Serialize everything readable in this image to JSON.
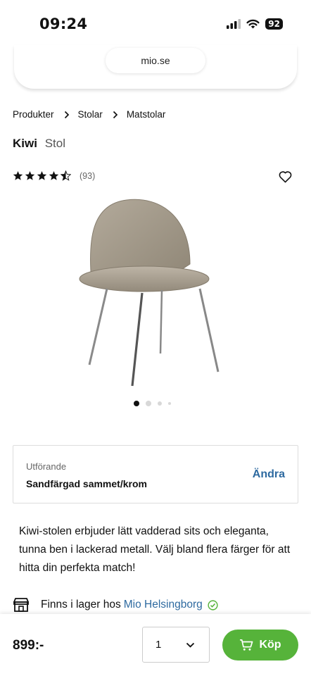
{
  "status": {
    "time": "09:24",
    "battery": "92"
  },
  "browser": {
    "url": "mio.se"
  },
  "breadcrumb": [
    "Produkter",
    "Stolar",
    "Matstolar"
  ],
  "product": {
    "name": "Kiwi",
    "type": "Stol",
    "rating": 4.5,
    "review_count": "(93)",
    "image_count": 4,
    "active_image": 1
  },
  "variant": {
    "label": "Utförande",
    "value": "Sandfärgad sammet/krom",
    "change_label": "Ändra"
  },
  "description": "Kiwi-stolen erbjuder lätt vadderad sits och eleganta, tunna ben i lackerad metall. Välj bland flera färger för att hitta din perfekta match!",
  "stock": {
    "text": "Finns i lager hos",
    "store": "Mio Helsingborg"
  },
  "purchase": {
    "price": "899:-",
    "quantity": "1",
    "buy_label": "Köp"
  },
  "colors": {
    "link": "#2e6aa0",
    "buy": "#56b33a",
    "check": "#56b33a"
  },
  "icons": [
    "signal-icon",
    "wifi-icon",
    "chevron-right-icon",
    "star-icon",
    "heart-icon",
    "store-icon",
    "check-circle-icon",
    "chevron-down-icon",
    "cart-icon"
  ]
}
